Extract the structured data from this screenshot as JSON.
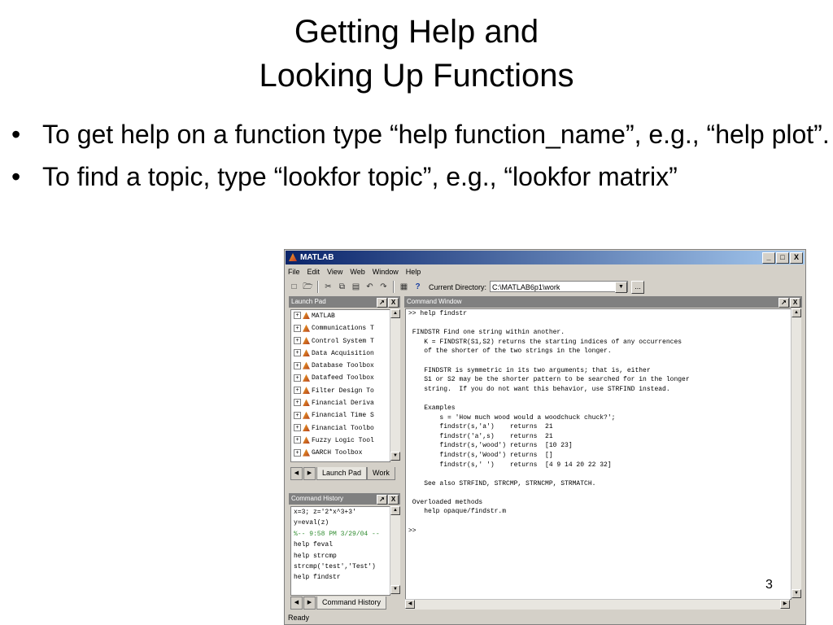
{
  "slide": {
    "title_line1": "Getting Help and",
    "title_line2": "Looking Up Functions",
    "bullets": [
      "To get help on a function type “help function_name”, e.g., “help plot”.",
      "To find a topic, type “lookfor topic”, e.g., “lookfor matrix”"
    ],
    "bullet_glyph": "•",
    "page_number": "3"
  },
  "matlab": {
    "window_title": "MATLAB",
    "window_buttons": [
      "_",
      "□",
      "X"
    ],
    "menu": [
      "File",
      "Edit",
      "View",
      "Web",
      "Window",
      "Help"
    ],
    "toolbar_icons": [
      "new-file-icon",
      "open-folder-icon",
      "cut-icon",
      "copy-icon",
      "paste-icon",
      "undo-icon",
      "redo-icon",
      "simulink-icon",
      "help-icon"
    ],
    "help_glyph": "?",
    "current_directory_label": "Current Directory:",
    "current_directory_value": "C:\\MATLAB6p1\\work",
    "browse_label": "...",
    "launch_pad": {
      "title": "Launch Pad",
      "items": [
        "MATLAB",
        "Communications T",
        "Control System T",
        "Data Acquisition",
        "Database Toolbox",
        "Datafeed Toolbox",
        "Filter Design To",
        "Financial Deriva",
        "Financial Time S",
        "Financial Toolbo",
        "Fuzzy Logic Tool",
        "GARCH Toolbox"
      ],
      "tabs": [
        "Launch Pad",
        "Work"
      ]
    },
    "command_history": {
      "title": "Command History",
      "items": [
        "x=3; z='2*x^3+3'",
        "y=eval(z)",
        "%-- 9:58 PM 3/29/04 --",
        "help feval",
        "help strcmp",
        "strcmp('test','Test')",
        "help findstr"
      ],
      "tab": "Command History"
    },
    "command_window": {
      "title": "Command Window",
      "lines": [
        ">> help findstr",
        "",
        " FINDSTR Find one string within another.",
        "    K = FINDSTR(S1,S2) returns the starting indices of any occurrences",
        "    of the shorter of the two strings in the longer.",
        "",
        "    FINDSTR is symmetric in its two arguments; that is, either",
        "    S1 or S2 may be the shorter pattern to be searched for in the longer",
        "    string.  If you do not want this behavior, use STRFIND instead.",
        "",
        "    Examples",
        "        s = 'How much wood would a woodchuck chuck?';",
        "        findstr(s,'a')    returns  21",
        "        findstr('a',s)    returns  21",
        "        findstr(s,'wood') returns  [10 23]",
        "        findstr(s,'Wood') returns  []",
        "        findstr(s,' ')    returns  [4 9 14 20 22 32]",
        "",
        "    See also STRFIND, STRCMP, STRNCMP, STRMATCH.",
        "",
        " Overloaded methods",
        "    help opaque/findstr.m",
        "",
        ">>"
      ]
    },
    "status": "Ready",
    "panel_buttons": [
      "↗",
      "X"
    ]
  }
}
